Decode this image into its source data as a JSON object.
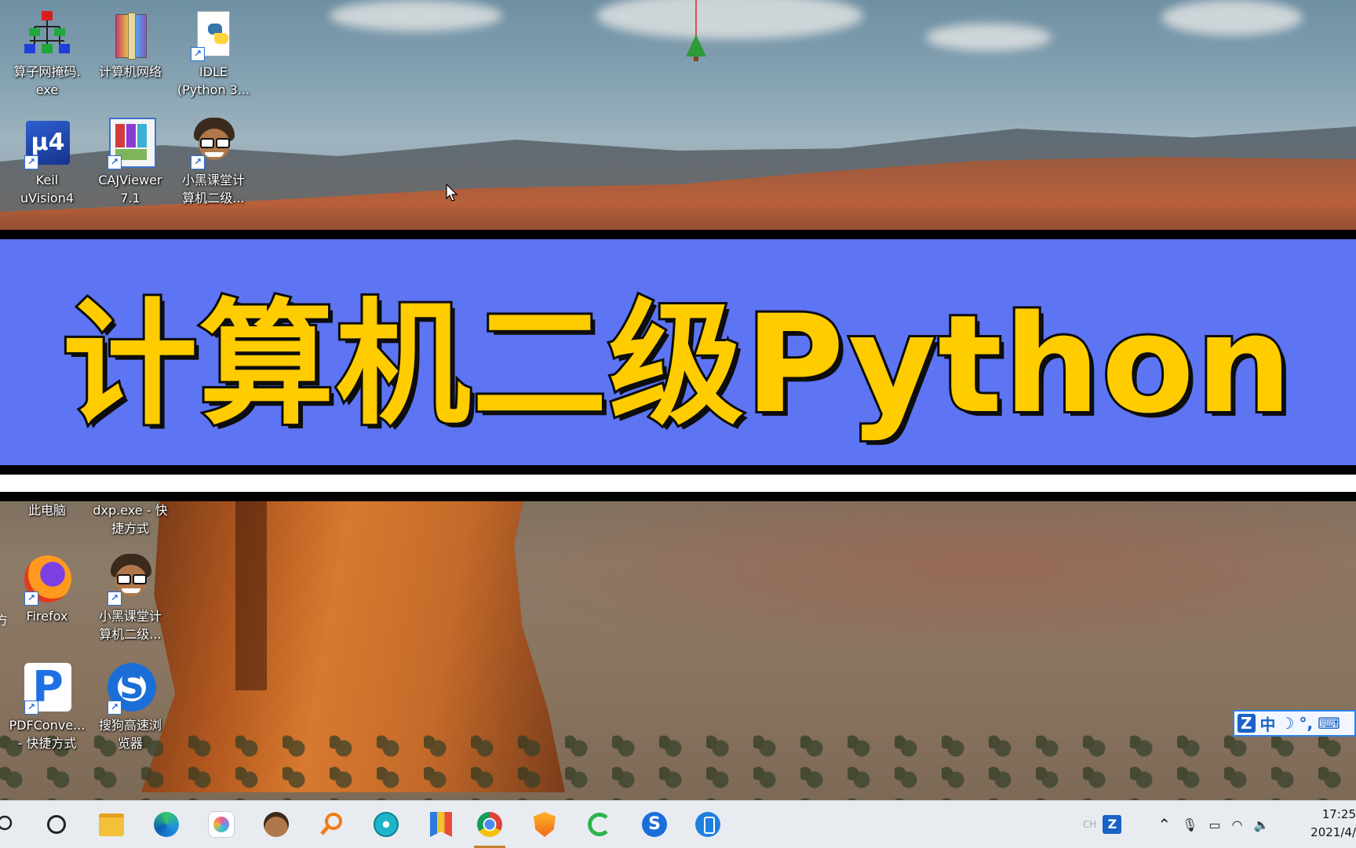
{
  "banner": {
    "title": "计算机二级Python"
  },
  "desktop_icons": [
    {
      "label_line1": "算子网掩码.",
      "label_line2": "exe",
      "icon": "network-tree-icon"
    },
    {
      "label_line1": "计算机网络",
      "label_line2": "",
      "icon": "winrar-archive-icon"
    },
    {
      "label_line1": "IDLE",
      "label_line2": "(Python 3...",
      "icon": "python-idle-icon"
    },
    {
      "label_line1": "Keil",
      "label_line2": "uVision4",
      "icon": "keil-uvision-icon"
    },
    {
      "label_line1": "CAJViewer",
      "label_line2": "7.1",
      "icon": "cajviewer-icon"
    },
    {
      "label_line1": "小黑课堂计",
      "label_line2": "算机二级...",
      "icon": "avatar-glasses-icon"
    },
    {
      "label_line1": "此电脑",
      "label_line2": "",
      "icon": "this-pc-icon"
    },
    {
      "label_line1": "dxp.exe - 快",
      "label_line2": "捷方式",
      "icon": "dxp-icon"
    },
    {
      "label_line1": "Firefox",
      "label_line2": "",
      "icon": "firefox-icon"
    },
    {
      "label_line1": "小黑课堂计",
      "label_line2": "算机二级...",
      "icon": "avatar-glasses-icon"
    },
    {
      "label_line1": "PDFConve...",
      "label_line2": "- 快捷方式",
      "icon": "pdf-converter-icon"
    },
    {
      "label_line1": "搜狗高速浏",
      "label_line2": "览器",
      "icon": "sogou-browser-icon"
    }
  ],
  "edge_fragments": {
    "left_char": "方"
  },
  "ime_toolbar": {
    "mode": "中",
    "logo": "Z"
  },
  "taskbar": {
    "tray_lang": "CH",
    "clock_time": "17:25",
    "clock_date": "2021/4/"
  },
  "colors": {
    "banner_bg": "#5d75f3",
    "banner_text": "#ffcc00",
    "taskbar_bg": "#e8ecf1",
    "active_indicator": "#c5812f"
  }
}
